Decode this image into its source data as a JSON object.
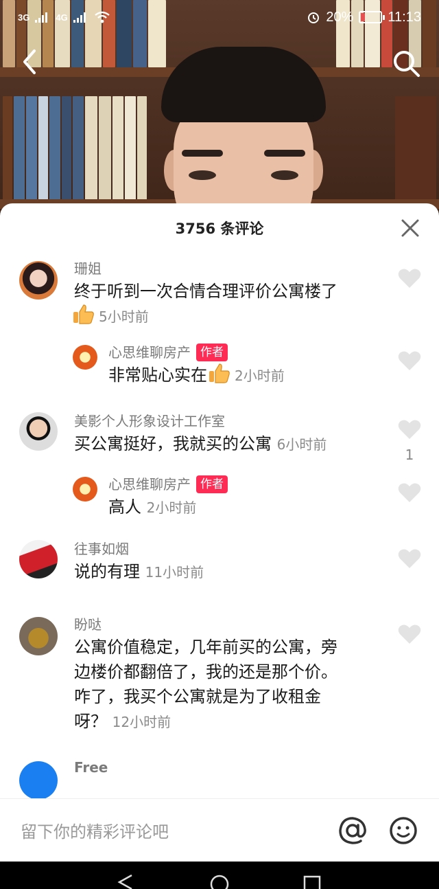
{
  "status": {
    "signal1": "3G",
    "signal2": "4G",
    "battery_percent": "20%",
    "battery_level": 0.2,
    "time": "11:13"
  },
  "sheet": {
    "title": "3756 条评论"
  },
  "comments": [
    {
      "user": "珊姐",
      "text": "终于听到一次合情合理评价公寓楼了",
      "thumb": true,
      "time": "5小时前",
      "likes": ""
    },
    {
      "user": "心思维聊房产",
      "badge": "作者",
      "text": "非常贴心实在",
      "thumb": true,
      "time": "2小时前",
      "likes": "",
      "reply": true
    },
    {
      "user": "美影个人形象设计工作室",
      "text": "买公寓挺好，我就买的公寓",
      "time": "6小时前",
      "likes": "1"
    },
    {
      "user": "心思维聊房产",
      "badge": "作者",
      "text": "高人",
      "time": "2小时前",
      "likes": "",
      "reply": true
    },
    {
      "user": "往事如烟",
      "text": "说的有理",
      "time": "11小时前",
      "likes": ""
    },
    {
      "user": "盼哒",
      "text_lines": [
        "公寓价值稳定，几年前买的公寓，旁",
        "边楼价都翻倍了，我的还是那个价。",
        "咋了，我买个公寓就是为了收租金"
      ],
      "text_last": "呀？",
      "time": "12小时前",
      "likes": ""
    },
    {
      "user": "Free"
    }
  ],
  "input": {
    "placeholder": "留下你的精彩评论吧"
  },
  "colors": {
    "accent": "#fe2c55",
    "like_gray": "#e3e3e3"
  },
  "icons": [
    "back-icon",
    "search-icon",
    "close-icon",
    "heart-icon",
    "thumbs-up-icon",
    "at-icon",
    "emoji-icon"
  ]
}
